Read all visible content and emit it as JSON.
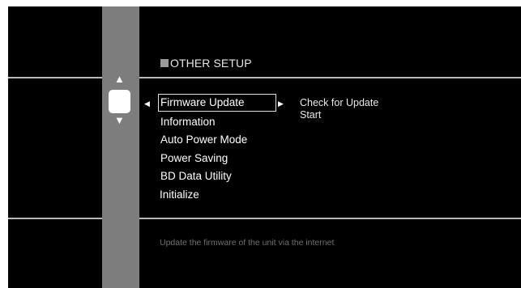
{
  "screen": {
    "title": "OTHER SETUP",
    "menu": [
      {
        "label": "Firmware Update",
        "selected": true
      },
      {
        "label": "Information",
        "selected": false
      },
      {
        "label": "Auto Power Mode",
        "selected": false
      },
      {
        "label": "Power Saving",
        "selected": false
      },
      {
        "label": "BD Data Utility",
        "selected": false
      },
      {
        "label": "Initialize",
        "selected": false
      }
    ],
    "submenu": [
      "Check for Update",
      "Start"
    ],
    "help_text": "Update the firmware of the unit via the internet"
  },
  "icons": {
    "up": "up-arrow-icon",
    "down": "down-arrow-icon",
    "left": "left-caret-icon",
    "right": "right-caret-icon",
    "title_marker": "square-bullet-icon"
  },
  "colors": {
    "background": "#000000",
    "strip": "#7d7d7d",
    "rule": "#b9b9b9",
    "text": "#ffffff",
    "help_text": "#6f6f6f"
  }
}
